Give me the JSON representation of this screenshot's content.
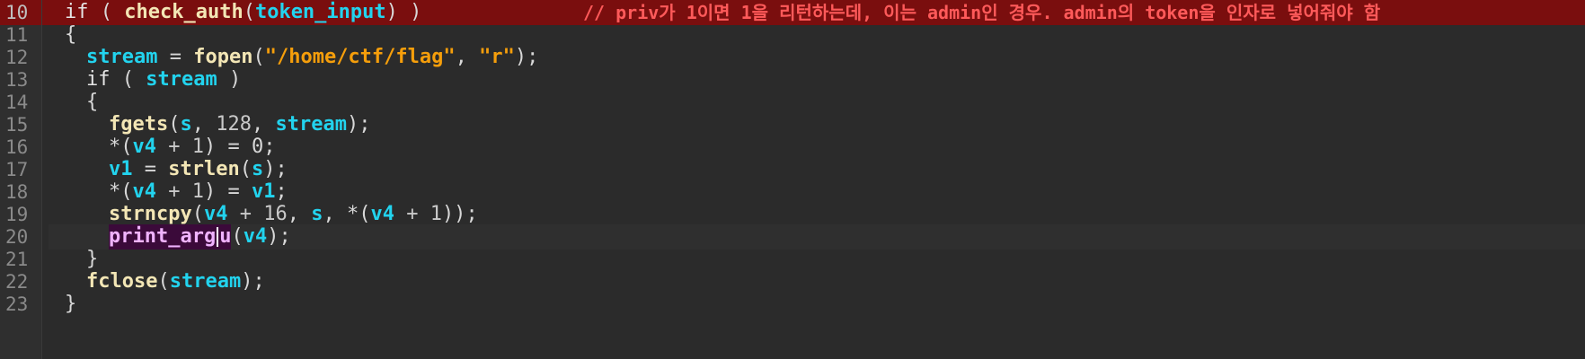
{
  "editor": {
    "line_numbers": [
      "10",
      "11",
      "12",
      "13",
      "14",
      "15",
      "16",
      "17",
      "18",
      "19",
      "20",
      "21",
      "22",
      "23"
    ],
    "lines": [
      {
        "id": "10",
        "text": "if ( check_auth(token_input) )"
      },
      {
        "id": "11",
        "text": "{"
      },
      {
        "id": "12",
        "text": "stream = fopen(\"/home/ctf/flag\", \"r\");"
      },
      {
        "id": "13",
        "text": "if ( stream )"
      },
      {
        "id": "14",
        "text": "{"
      },
      {
        "id": "15",
        "text": "fgets(s, 128, stream);"
      },
      {
        "id": "16",
        "text": "*(v4 + 1) = 0;"
      },
      {
        "id": "17",
        "text": "v1 = strlen(s);"
      },
      {
        "id": "18",
        "text": "*(v4 + 1) = v1;"
      },
      {
        "id": "19",
        "text": "strncpy(v4 + 16, s, *(v4 + 1));"
      },
      {
        "id": "20",
        "text": "print_argu(v4);"
      },
      {
        "id": "21",
        "text": "}"
      },
      {
        "id": "22",
        "text": "fclose(stream);"
      },
      {
        "id": "23",
        "text": "}"
      }
    ],
    "comment_line_10": "// priv가 1이면 1을 리턴하는데, 이는 admin인 경우. admin의 token을 인자로 넣어줘야 함",
    "tokens": {
      "if": "if",
      "paren_open": "(",
      "paren_close": ")",
      "check_auth": "check_auth",
      "token_input": "token_input",
      "brace_open": "{",
      "brace_close": "}",
      "stream": "stream",
      "eq": "=",
      "fopen": "fopen",
      "path": "\"/home/ctf/flag\"",
      "mode": "\"r\"",
      "comma_space": ", ",
      "semi": ";",
      "fgets": "fgets",
      "s": "s",
      "n128": "128",
      "deref_open": "*(",
      "v4": "v4",
      "plus_1": " + 1",
      "assign_zero": ") = 0;",
      "v1": "v1",
      "strlen": "strlen",
      "strncpy": "strncpy",
      "plus_16": " + 16",
      "print_arg": "print_arg",
      "print_u": "u",
      "fclose": "fclose"
    },
    "colors": {
      "background": "#2b2b2b",
      "error_line": "#7a0e0e",
      "comment": "#ff5a5a",
      "identifier": "#22d3ee",
      "string": "#f59e0b",
      "function": "#f3e6b5"
    }
  }
}
